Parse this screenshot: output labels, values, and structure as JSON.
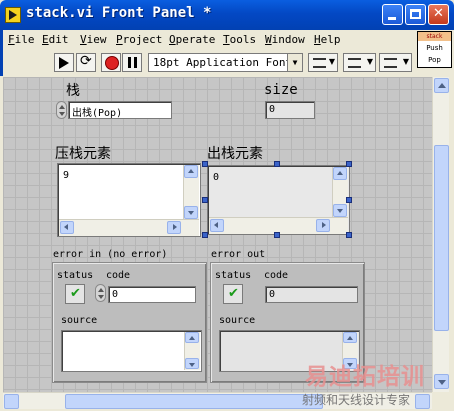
{
  "window": {
    "title": "stack.vi Front Panel *",
    "min_glyph": "",
    "max_glyph": "",
    "close_glyph": "✕"
  },
  "menu": {
    "file": {
      "u": "F",
      "rest": "ile"
    },
    "edit": {
      "u": "E",
      "rest": "dit"
    },
    "view": {
      "u": "V",
      "rest": "iew"
    },
    "project": {
      "u": "P",
      "rest": "roject"
    },
    "operate": {
      "u": "O",
      "rest": "perate"
    },
    "tools": {
      "u": "T",
      "rest": "ools"
    },
    "window": {
      "u": "W",
      "rest": "indow"
    },
    "help": {
      "u": "H",
      "rest": "elp"
    }
  },
  "toolbar": {
    "font_select": "18pt Application Font",
    "dropdown_glyph": "▼"
  },
  "vi_icon": {
    "header": "stack",
    "line1": "Push",
    "line2": "Pop"
  },
  "controls": {
    "stack_label": "栈",
    "stack_value": "出栈(Pop)",
    "size_label": "size",
    "size_value": "0",
    "push_label": "压栈元素",
    "push_value": "9",
    "pop_label": "出栈元素",
    "pop_value": "0"
  },
  "error_in": {
    "title": "error in (no error)",
    "status_label": "status",
    "code_label": "code",
    "code_value": "0",
    "source_label": "source",
    "status_glyph": "✔"
  },
  "error_out": {
    "title": "error out",
    "status_label": "status",
    "code_label": "code",
    "code_value": "0",
    "source_label": "source",
    "status_glyph": "✔"
  },
  "watermark": {
    "line1": "易迪拓培训",
    "line2": "射频和天线设计专家"
  }
}
